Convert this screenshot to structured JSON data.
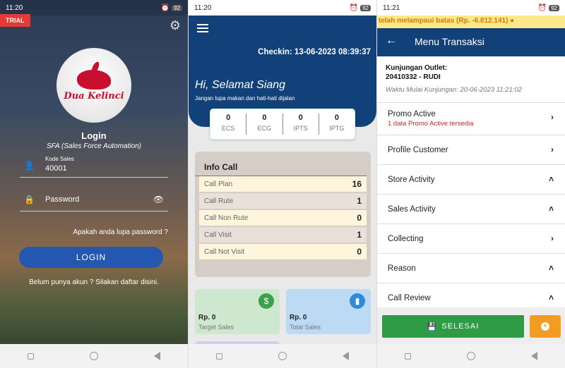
{
  "login_screen": {
    "status_time": "11:20",
    "battery": "92",
    "trial_badge": "TRIAL",
    "brand": "Dua Kelinci",
    "title": "Login",
    "subtitle": "SFA (Sales Force Automation)",
    "kode_sales_label": "Kode Sales",
    "kode_sales_value": "40001",
    "password_placeholder": "Password",
    "forgot_link": "Apakah anda lupa password ?",
    "login_button": "LOGIN",
    "register_text": "Belum punya akun ? Silakan daftar disini."
  },
  "home_screen": {
    "status_time": "11:20",
    "battery": "92",
    "checkin": "Checkin: 13-06-2023 08:39:37",
    "greeting": "Hi, Selamat Siang",
    "greeting_msg": "Jangan lupa makan dan hati-hati dijalan",
    "stats": [
      {
        "value": "0",
        "label": "ECS"
      },
      {
        "value": "0",
        "label": "ECG"
      },
      {
        "value": "0",
        "label": "IPTS"
      },
      {
        "value": "0",
        "label": "IPTG"
      }
    ],
    "info_call": {
      "title": "Info Call",
      "rows": [
        {
          "label": "Call Plan",
          "value": "16"
        },
        {
          "label": "Call Rute",
          "value": "1"
        },
        {
          "label": "Call Non Rute",
          "value": "0"
        },
        {
          "label": "Call Visit",
          "value": "1"
        },
        {
          "label": "Call Not Visit",
          "value": "0"
        }
      ]
    },
    "cards": [
      {
        "amount": "Rp. 0",
        "label": "Target Sales",
        "icon": "dollar-icon"
      },
      {
        "amount": "Rp. 0",
        "label": "Total Sales",
        "icon": "bar-chart-icon"
      }
    ]
  },
  "transaksi_screen": {
    "status_time": "11:21",
    "battery": "92",
    "marquee": "telah melampaui batas (Rp. -6.812.141) ●",
    "title": "Menu Transaksi",
    "outlet_label": "Kunjungan Outlet:",
    "outlet_value": "20410332 - RUDI",
    "visit_start": "Waktu Mulai Kunjungan: 20-06-2023 11:21:02",
    "menu": [
      {
        "label": "Promo Active",
        "sub": "1 data Promo Active tersedia",
        "chevron": "›"
      },
      {
        "label": "Profile Customer",
        "sub": "",
        "chevron": "›"
      },
      {
        "label": "Store Activity",
        "sub": "",
        "chevron": "˄"
      },
      {
        "label": "Sales Activity",
        "sub": "",
        "chevron": "˄"
      },
      {
        "label": "Collecting",
        "sub": "",
        "chevron": "›"
      },
      {
        "label": "Reason",
        "sub": "",
        "chevron": "˄"
      },
      {
        "label": "Call Review",
        "sub": "",
        "chevron": "˄"
      }
    ],
    "selesai_button": "SELESAI"
  },
  "colors": {
    "primary": "#12417a",
    "login_button": "#2458b0",
    "success": "#2e9c46",
    "warning": "#f39c23",
    "danger": "#c62828"
  }
}
